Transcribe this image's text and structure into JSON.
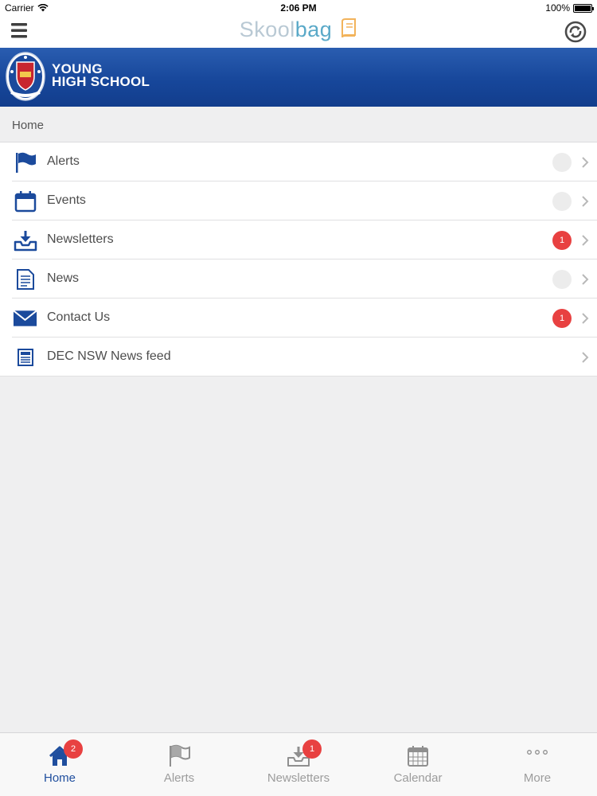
{
  "status_bar": {
    "carrier": "Carrier",
    "time": "2:06 PM",
    "battery": "100%"
  },
  "nav": {
    "logo_part1": "Skool",
    "logo_part2": "bag",
    "menu_icon": "hamburger-icon",
    "sync_icon": "sync-icon"
  },
  "banner": {
    "school_line1": "YOUNG",
    "school_line2": "HIGH SCHOOL",
    "crest_icon": "school-crest-icon",
    "color": "#17479b"
  },
  "breadcrumb": {
    "label": "Home"
  },
  "menu": {
    "items": [
      {
        "label": "Alerts",
        "icon": "flag-icon",
        "badge": "",
        "has_badge": true
      },
      {
        "label": "Events",
        "icon": "calendar-icon",
        "badge": "",
        "has_badge": true
      },
      {
        "label": "Newsletters",
        "icon": "inbox-download-icon",
        "badge": "1",
        "has_badge": true
      },
      {
        "label": "News",
        "icon": "document-icon",
        "badge": "",
        "has_badge": true
      },
      {
        "label": "Contact Us",
        "icon": "envelope-icon",
        "badge": "1",
        "has_badge": true
      },
      {
        "label": "DEC NSW News feed",
        "icon": "newspaper-icon",
        "badge": "",
        "has_badge": false
      }
    ]
  },
  "tabs": {
    "items": [
      {
        "label": "Home",
        "icon": "home-icon",
        "badge": "2",
        "active": true
      },
      {
        "label": "Alerts",
        "icon": "flag-icon",
        "badge": "",
        "active": false
      },
      {
        "label": "Newsletters",
        "icon": "inbox-download-icon",
        "badge": "1",
        "active": false
      },
      {
        "label": "Calendar",
        "icon": "calendar-grid-icon",
        "badge": "",
        "active": false
      },
      {
        "label": "More",
        "icon": "more-dots-icon",
        "badge": "",
        "active": false
      }
    ]
  },
  "colors": {
    "brand_blue": "#1f4e9e",
    "badge_red": "#e84141",
    "badge_empty": "#ececec",
    "inactive_tab": "#9c9c9c"
  }
}
